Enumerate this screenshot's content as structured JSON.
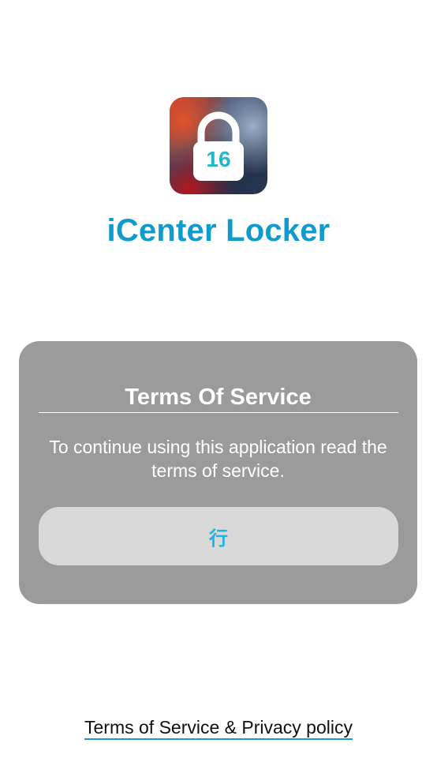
{
  "app": {
    "icon_name": "padlock-icon",
    "icon_badge": "16",
    "title": "iCenter Locker"
  },
  "dialog": {
    "heading": "Terms Of Service",
    "message": "To continue using this application read the terms of service.",
    "button_label": "行"
  },
  "footer": {
    "link_label": "Terms of Service & Privacy policy"
  },
  "colors": {
    "title": "#0f9ccc",
    "card_background": "#9b9b9b",
    "button_background": "#d9d9d9",
    "button_text": "#1eb3e0",
    "link_underline": "#1e9bd6"
  }
}
